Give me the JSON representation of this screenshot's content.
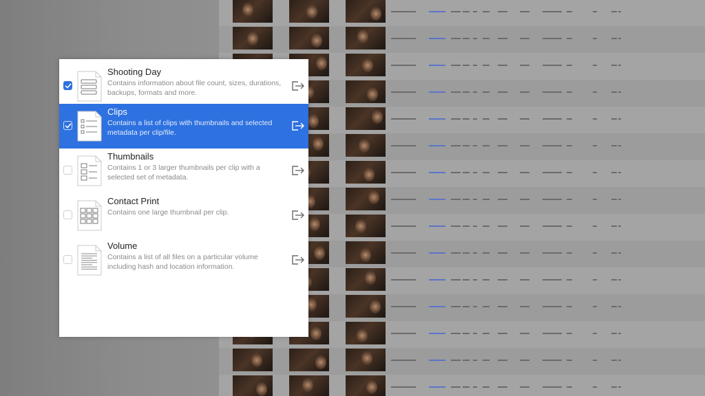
{
  "templates": [
    {
      "title": "Shooting Day",
      "description": "Contains information about file count, sizes, durations, backups, formats and more.",
      "checked": true,
      "selected": false,
      "icon": "document-summary-icon"
    },
    {
      "title": "Clips",
      "description": "Contains a list of clips with thumbnails and selected metadata per clip/file.",
      "checked": true,
      "selected": true,
      "icon": "document-list-icon"
    },
    {
      "title": "Thumbnails",
      "description": "Contains 1 or 3 larger thumbnails per clip with a selected set of metadata.",
      "checked": false,
      "selected": false,
      "icon": "document-thumbnails-icon"
    },
    {
      "title": "Contact Print",
      "description": "Contains one large thumbnail per clip.",
      "checked": false,
      "selected": false,
      "icon": "document-grid-icon"
    },
    {
      "title": "Volume",
      "description": "Contains a list of all files on a particular volume including hash and location information.",
      "checked": false,
      "selected": false,
      "icon": "document-lines-icon"
    }
  ],
  "colors": {
    "accent": "#2e71e0",
    "panel": "#ffffff",
    "description": "#8a8a8a",
    "link": "#2a4cc8"
  }
}
